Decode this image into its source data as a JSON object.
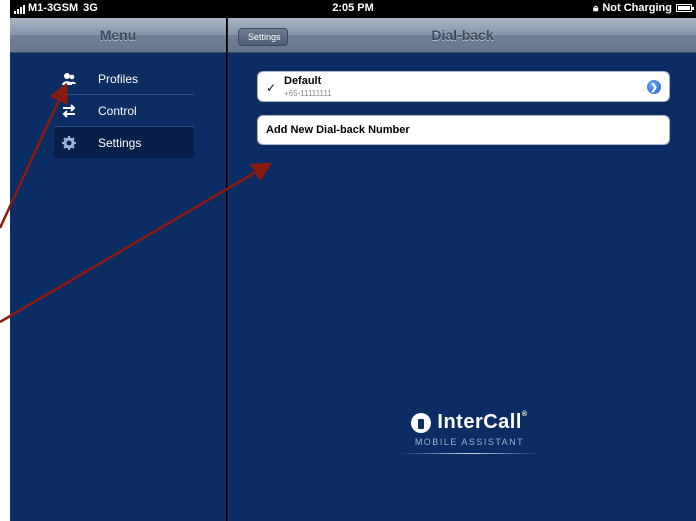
{
  "status_bar": {
    "carrier": "M1-3GSM",
    "network": "3G",
    "time": "2:05 PM",
    "charging": "Not Charging"
  },
  "menu": {
    "title": "Menu",
    "items": [
      {
        "label": "Profiles",
        "icon": "profiles-icon"
      },
      {
        "label": "Control",
        "icon": "control-arrows-icon"
      },
      {
        "label": "Settings",
        "icon": "gear-icon",
        "selected": true
      }
    ]
  },
  "detail": {
    "back_label": "Settings",
    "title": "Dial-back",
    "default_entry": {
      "name": "Default",
      "number": "+65-11111111",
      "checked": true
    },
    "add_label": "Add New Dial-back Number"
  },
  "logo": {
    "name": "InterCall",
    "mark": "®",
    "tagline": "MOBILE ASSISTANT"
  },
  "colors": {
    "background": "#0c2d63",
    "annotation_arrow": "#8b1a10"
  }
}
